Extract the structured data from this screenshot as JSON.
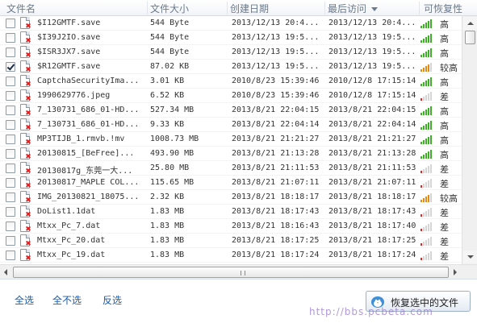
{
  "header": {
    "name": "文件名",
    "size": "文件大小",
    "created": "创建日期",
    "accessed": "最后访问",
    "recoverability": "可恢复性"
  },
  "files": [
    {
      "name": "$I12GMTF.save",
      "size": "544 Byte",
      "created": "2013/12/13 20:4...",
      "accessed": "2013/12/13 20:4...",
      "level": "高",
      "bars": 5,
      "color": "#3fae29",
      "checked": false
    },
    {
      "name": "$I39J2IO.save",
      "size": "544 Byte",
      "created": "2013/12/13 19:5...",
      "accessed": "2013/12/13 19:5...",
      "level": "高",
      "bars": 5,
      "color": "#3fae29",
      "checked": false
    },
    {
      "name": "$ISR3JX7.save",
      "size": "544 Byte",
      "created": "2013/12/13 19:5...",
      "accessed": "2013/12/13 19:5...",
      "level": "高",
      "bars": 5,
      "color": "#3fae29",
      "checked": false
    },
    {
      "name": "$R12GMTF.save",
      "size": "87.02 KB",
      "created": "2013/12/13 19:5...",
      "accessed": "2013/12/13 19:5...",
      "level": "较高",
      "bars": 4,
      "color": "#e08a1e",
      "checked": true
    },
    {
      "name": "CaptchaSecurityIma...",
      "size": "3.01 KB",
      "created": "2010/8/23 15:39:46",
      "accessed": "2010/12/8 17:15:14",
      "level": "高",
      "bars": 5,
      "color": "#3fae29",
      "checked": false
    },
    {
      "name": "1990629776.jpeg",
      "size": "6.52 KB",
      "created": "2010/8/23 15:39:46",
      "accessed": "2010/12/8 17:15:14",
      "level": "差",
      "bars": 1,
      "color": "#d42a2a",
      "checked": false
    },
    {
      "name": "7_130731_686_01-HD...",
      "size": "527.34 MB",
      "created": "2013/8/21 22:04:15",
      "accessed": "2013/8/21 22:04:15",
      "level": "高",
      "bars": 5,
      "color": "#3fae29",
      "checked": false
    },
    {
      "name": "7_130731_686_01-HD...",
      "size": "9.33 KB",
      "created": "2013/8/21 22:04:14",
      "accessed": "2013/8/21 22:04:14",
      "level": "高",
      "bars": 5,
      "color": "#3fae29",
      "checked": false
    },
    {
      "name": "MP3TIJB_1.rmvb.!mv",
      "size": "1008.73 MB",
      "created": "2013/8/21 21:21:27",
      "accessed": "2013/8/21 21:21:27",
      "level": "高",
      "bars": 5,
      "color": "#3fae29",
      "checked": false
    },
    {
      "name": "20130815_[BeFree]...",
      "size": "493.90 MB",
      "created": "2013/8/21 21:13:28",
      "accessed": "2013/8/21 21:13:28",
      "level": "高",
      "bars": 5,
      "color": "#3fae29",
      "checked": false
    },
    {
      "name": "20130817g_东莞一大...",
      "size": "25.80 MB",
      "created": "2013/8/21 21:11:53",
      "accessed": "2013/8/21 21:11:53",
      "level": "差",
      "bars": 1,
      "color": "#d42a2a",
      "checked": false
    },
    {
      "name": "20130817_MAPLE COL...",
      "size": "115.65 MB",
      "created": "2013/8/21 21:07:11",
      "accessed": "2013/8/21 21:07:11",
      "level": "差",
      "bars": 1,
      "color": "#d42a2a",
      "checked": false
    },
    {
      "name": "IMG_20130821_18075...",
      "size": "2.32 KB",
      "created": "2013/8/21 18:18:17",
      "accessed": "2013/8/21 18:18:17",
      "level": "较高",
      "bars": 4,
      "color": "#e08a1e",
      "checked": false
    },
    {
      "name": "DoList1.1dat",
      "size": "1.83 MB",
      "created": "2013/8/21 18:17:43",
      "accessed": "2013/8/21 18:17:43",
      "level": "差",
      "bars": 1,
      "color": "#d42a2a",
      "checked": false
    },
    {
      "name": "Mtxx_Pc_7.dat",
      "size": "1.83 MB",
      "created": "2013/8/21 18:16:43",
      "accessed": "2013/8/21 18:17:40",
      "level": "差",
      "bars": 1,
      "color": "#d42a2a",
      "checked": false
    },
    {
      "name": "Mtxx_Pc_20.dat",
      "size": "1.83 MB",
      "created": "2013/8/21 18:17:25",
      "accessed": "2013/8/21 18:17:25",
      "level": "差",
      "bars": 1,
      "color": "#d42a2a",
      "checked": false
    },
    {
      "name": "Mtxx_Pc_19.dat",
      "size": "1.83 MB",
      "created": "2013/8/21 18:17:24",
      "accessed": "2013/8/21 18:17:24",
      "level": "差",
      "bars": 1,
      "color": "#d42a2a",
      "checked": false
    }
  ],
  "footer": {
    "select_all": "全选",
    "select_none": "全不选",
    "invert": "反选",
    "recover_button": "恢复选中的文件",
    "watermark": "http://bbs.pcbeta.com"
  },
  "icons": {
    "file": "file-icon",
    "deleted": "deleted-mark-icon",
    "signal": "signal-bars-icon",
    "sort": "sort-desc-icon",
    "bird": "recover-bird-icon"
  },
  "colors": {
    "accent": "#1a5ba6",
    "header_text": "#6a7a8c",
    "high": "#3fae29",
    "medium": "#e08a1e",
    "poor": "#d42a2a"
  }
}
